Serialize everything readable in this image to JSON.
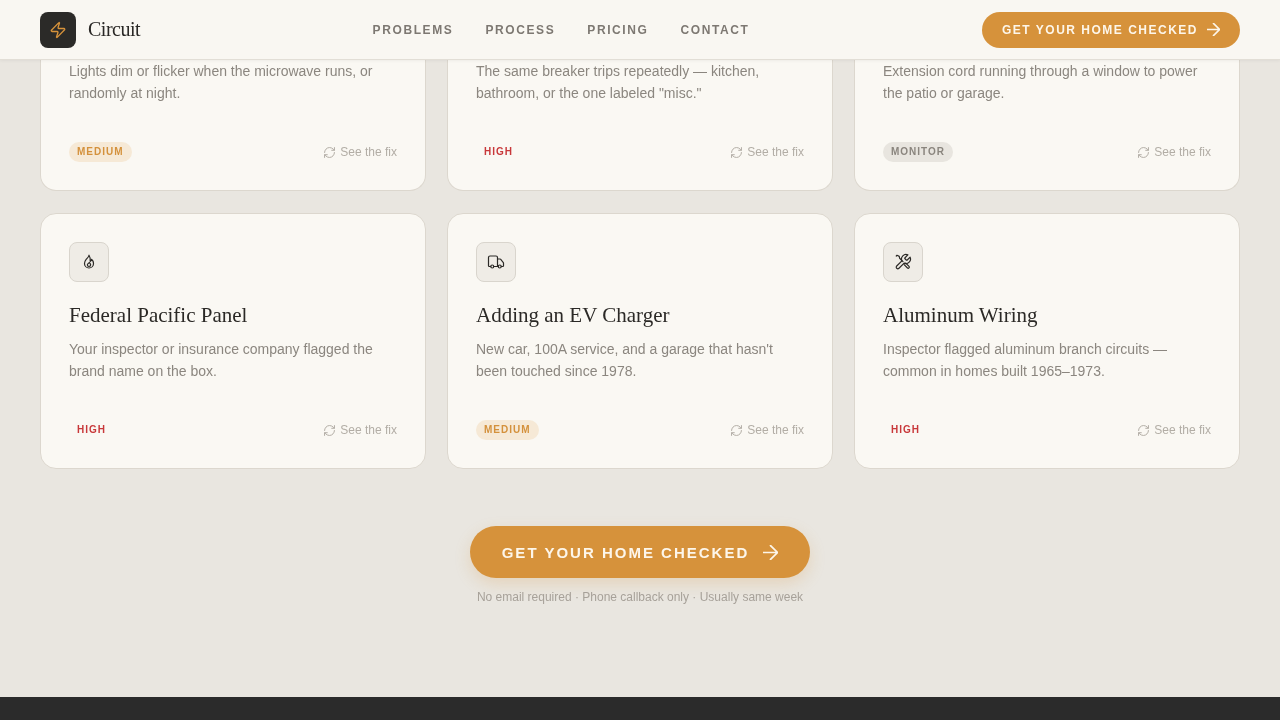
{
  "header": {
    "brand": "Circuit",
    "nav": [
      "PROBLEMS",
      "PROCESS",
      "PRICING",
      "CONTACT"
    ],
    "cta": "GET YOUR HOME CHECKED"
  },
  "cards": [
    {
      "kind": "clipped",
      "description": "Lights dim or flicker when the microwave runs, or randomly at night.",
      "badge": {
        "label": "MEDIUM",
        "kind": "medium"
      },
      "link": "See the fix"
    },
    {
      "kind": "clipped",
      "description": "The same breaker trips repeatedly — kitchen, bathroom, or the one labeled \"misc.\"",
      "badge": {
        "label": "HIGH",
        "kind": "high"
      },
      "link": "See the fix"
    },
    {
      "kind": "clipped",
      "description": "Extension cord running through a window to power the patio or garage.",
      "badge": {
        "label": "MONITOR",
        "kind": "monitor"
      },
      "link": "See the fix"
    },
    {
      "kind": "full",
      "title": "Federal Pacific Panel",
      "description": "Your inspector or insurance company flagged the brand name on the box.",
      "badge": {
        "label": "HIGH",
        "kind": "high"
      },
      "link": "See the fix"
    },
    {
      "kind": "full",
      "title": "Adding an EV Charger",
      "description": "New car, 100A service, and a garage that hasn't been touched since 1978.",
      "badge": {
        "label": "MEDIUM",
        "kind": "medium"
      },
      "link": "See the fix"
    },
    {
      "kind": "full",
      "title": "Aluminum Wiring",
      "description": "Inspector flagged aluminum branch circuits — common in homes built 1965–1973.",
      "badge": {
        "label": "HIGH",
        "kind": "high"
      },
      "link": "See the fix"
    }
  ],
  "call_to_action": {
    "button": "GET YOUR HOME CHECKED",
    "note": "No email required · Phone callback only · Usually same week"
  }
}
